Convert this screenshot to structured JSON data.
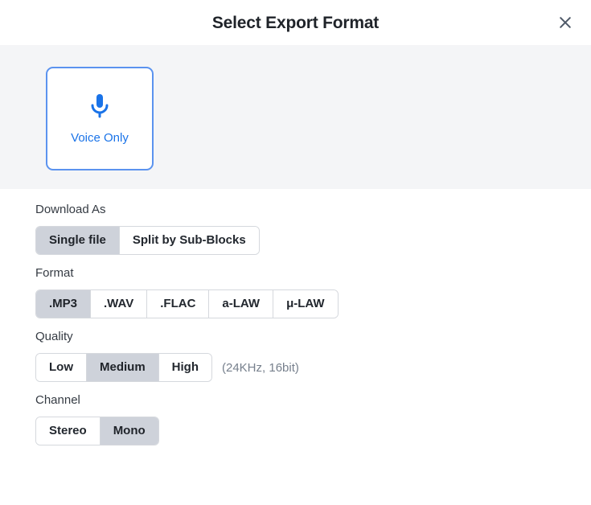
{
  "dialog": {
    "title": "Select Export Format",
    "close_label": "×",
    "close_icon": "close-icon"
  },
  "mode_banner": {
    "cards": [
      {
        "id": "voice-only",
        "label": "Voice Only",
        "icon": "microphone-icon",
        "selected": true,
        "accent_color": "#1a73e8",
        "border_color": "#5b93ef"
      }
    ]
  },
  "fields": {
    "download_as": {
      "label": "Download As",
      "options": [
        "Single file",
        "Split by Sub-Blocks"
      ],
      "selected": "Single file"
    },
    "format": {
      "label": "Format",
      "options": [
        ".MP3",
        ".WAV",
        ".FLAC",
        "a-LAW",
        "μ-LAW"
      ],
      "selected": ".MP3"
    },
    "quality": {
      "label": "Quality",
      "options": [
        "Low",
        "Medium",
        "High"
      ],
      "selected": "Medium",
      "hint": "(24KHz, 16bit)"
    },
    "channel": {
      "label": "Channel",
      "options": [
        "Stereo",
        "Mono"
      ],
      "selected": "Mono"
    }
  },
  "colors": {
    "accent": "#1a73e8",
    "banner_bg": "#f4f5f7",
    "segment_selected_bg": "#ced2da",
    "segment_border": "#d5d8dd",
    "hint_text": "#77808d",
    "title_text": "#1f2329"
  }
}
